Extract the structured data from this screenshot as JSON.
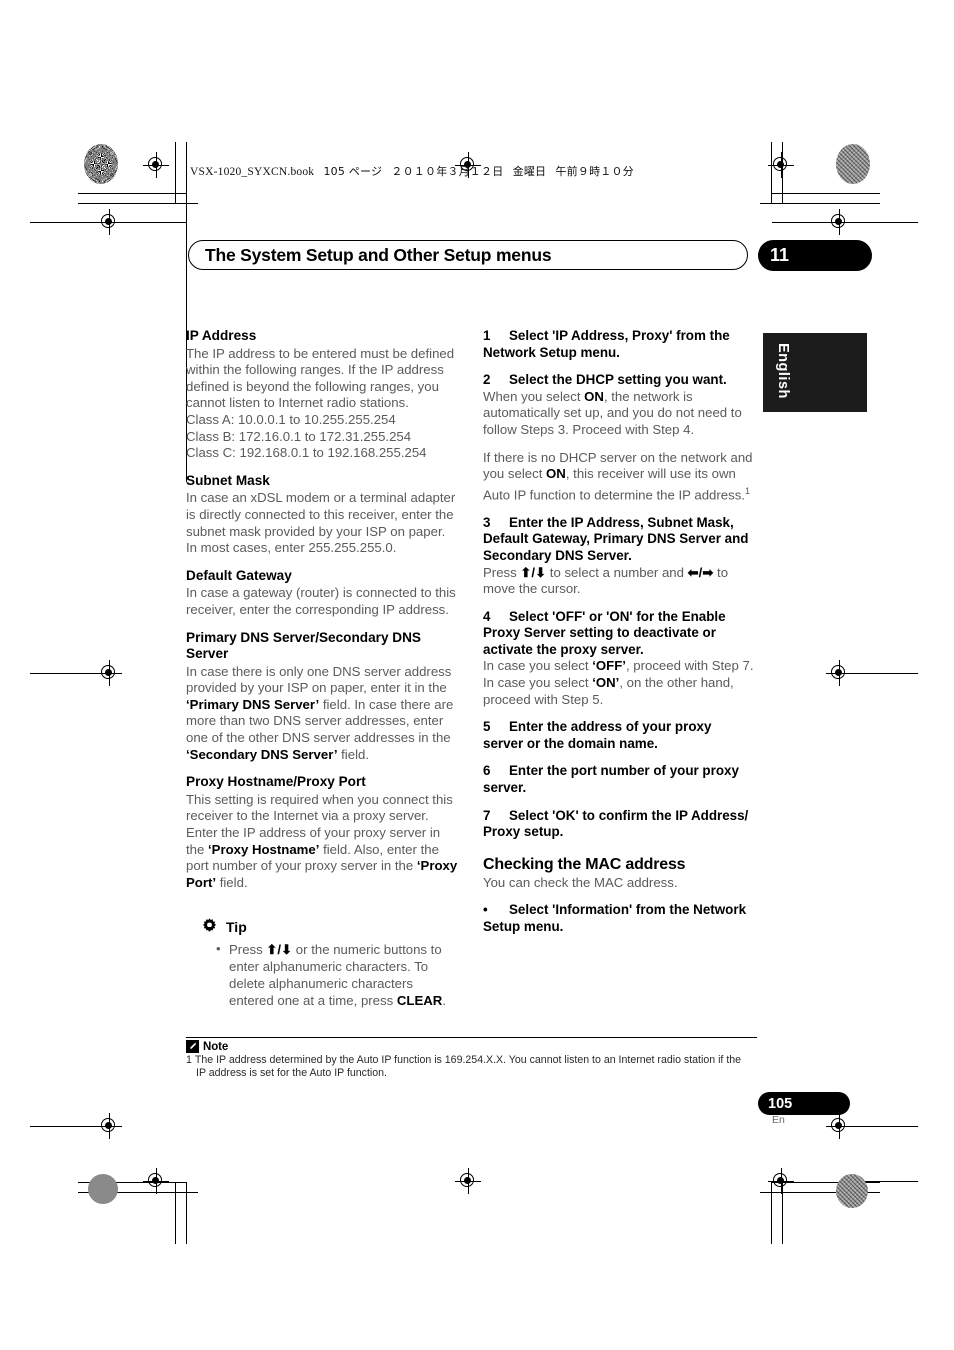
{
  "print_header": {
    "filename": "VSX-1020_SYXCN.book",
    "page_marker": "105 ページ",
    "date": "２０１０年３月１２日",
    "weekday": "金曜日",
    "time": "午前９時１０分"
  },
  "chapter": {
    "title": "The System Setup and Other Setup menus",
    "number": "11"
  },
  "language_tab": {
    "label": "English"
  },
  "left_column": {
    "sections": [
      {
        "heading": "IP Address",
        "paragraphs": [
          "The IP address to be entered must be defined within the following ranges. If the IP address defined is beyond the following ranges, you cannot listen to Internet radio stations.",
          "Class A: 10.0.0.1 to 10.255.255.254",
          "Class B: 172.16.0.1 to 172.31.255.254",
          "Class C: 192.168.0.1 to 192.168.255.254"
        ]
      },
      {
        "heading": "Subnet Mask",
        "paragraphs": [
          "In case an xDSL modem or a terminal adapter is directly connected to this receiver, enter the subnet mask provided by your ISP on paper. In most cases, enter 255.255.255.0."
        ]
      },
      {
        "heading": "Default Gateway",
        "paragraphs": [
          "In case a gateway (router) is connected to this receiver, enter the corresponding IP address."
        ]
      },
      {
        "heading": "Primary DNS Server/Secondary DNS Server",
        "paragraphs": [
          "In case there is only one DNS server address provided by your ISP on paper, enter it in the 'Primary DNS Server' field. In case there are more than two DNS server addresses, enter one of the other DNS server addresses in the 'Secondary DNS Server' field."
        ]
      },
      {
        "heading": "Proxy Hostname/Proxy Port",
        "paragraphs": [
          "This setting is required when you connect this receiver to the Internet via a proxy server. Enter the IP address of your proxy server in the 'Proxy Hostname' field. Also, enter the port number of your proxy server in the 'Proxy Port' field."
        ]
      }
    ],
    "tip": {
      "icon": "gear-icon",
      "label": "Tip",
      "items": [
        "Press ↑/↓ or the numeric buttons to enter alphanumeric characters. To delete alphanumeric characters entered one at a time, press CLEAR."
      ]
    }
  },
  "right_column": {
    "steps": [
      {
        "number": "1",
        "title": "Select 'IP Address, Proxy' from the Network Setup menu.",
        "body": []
      },
      {
        "number": "2",
        "title": "Select the DHCP setting you want.",
        "body": [
          "When you select ON, the network is automatically set up, and you do not need to follow Steps 3. Proceed with Step 4.",
          "If there is no DHCP server on the network and you select ON, this receiver will use its own Auto IP function to determine the IP address.1"
        ]
      },
      {
        "number": "3",
        "title": "Enter the IP Address, Subnet Mask, Default Gateway, Primary DNS Server and Secondary DNS Server.",
        "body": [
          "Press ↑/↓ to select a number and ←/→ to move the cursor."
        ]
      },
      {
        "number": "4",
        "title": "Select 'OFF' or 'ON' for the Enable Proxy Server setting to deactivate or activate the proxy server.",
        "body": [
          "In case you select 'OFF', proceed with Step 7. In case you select 'ON', on the other hand, proceed with Step 5."
        ]
      },
      {
        "number": "5",
        "title": "Enter the address of your proxy server or the domain name.",
        "body": []
      },
      {
        "number": "6",
        "title": "Enter the port number of your proxy server.",
        "body": []
      },
      {
        "number": "7",
        "title": "Select 'OK' to confirm the IP Address/ Proxy setup.",
        "body": []
      }
    ],
    "mac_section": {
      "heading": "Checking the MAC address",
      "intro": "You can check the MAC address.",
      "bullet_step": "Select 'Information' from the Network Setup menu."
    }
  },
  "note": {
    "icon": "note-pen-icon",
    "label": "Note",
    "index": "1",
    "text": "The IP address determined by the Auto IP function is 169.254.X.X. You cannot listen to an Internet radio station if the",
    "text_cont": "IP address is set for the Auto IP function."
  },
  "footer": {
    "page_number": "105",
    "language_code": "En"
  },
  "colors": {
    "ink_black": "#000000",
    "body_gray": "#5b5b5b",
    "tab_black": "#1c1c1c"
  }
}
